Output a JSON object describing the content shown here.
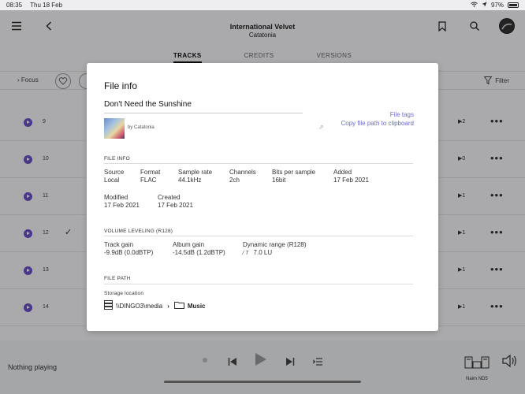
{
  "status": {
    "time": "08:35",
    "date": "Thu 18 Feb",
    "battery": "97%"
  },
  "header": {
    "album": "International Velvet",
    "artist": "Catatonia"
  },
  "tabs": [
    {
      "label": "TRACKS",
      "active": true
    },
    {
      "label": "CREDITS",
      "active": false
    },
    {
      "label": "VERSIONS",
      "active": false
    }
  ],
  "toolbar": {
    "focus_label": "Focus",
    "filter_label": "Filter"
  },
  "tracks": [
    {
      "num": "9",
      "plays": "2",
      "checked": false
    },
    {
      "num": "10",
      "plays": "0",
      "checked": false
    },
    {
      "num": "11",
      "plays": "1",
      "checked": false
    },
    {
      "num": "12",
      "plays": "1",
      "checked": true
    },
    {
      "num": "13",
      "plays": "1",
      "checked": false
    },
    {
      "num": "14",
      "plays": "1",
      "checked": false
    }
  ],
  "player": {
    "status_text": "Nothing playing",
    "device_label": "Naim ND5"
  },
  "modal": {
    "title": "File info",
    "track_title": "Don't Need the Sunshine",
    "links": {
      "file_tags": "File tags",
      "copy_path": "Copy file path to clipboard"
    },
    "by_prefix": "by",
    "by_artist": "Catatonia",
    "file_info": {
      "heading": "FILE INFO",
      "fields": [
        {
          "label": "Source",
          "value": "Local"
        },
        {
          "label": "Format",
          "value": "FLAC"
        },
        {
          "label": "Sample rate",
          "value": "44.1kHz"
        },
        {
          "label": "Channels",
          "value": "2ch"
        },
        {
          "label": "Bits per sample",
          "value": "16bit"
        },
        {
          "label": "Added",
          "value": "17 Feb 2021"
        },
        {
          "label": "Modified",
          "value": "17 Feb 2021"
        },
        {
          "label": "Created",
          "value": "17 Feb 2021"
        }
      ]
    },
    "leveling": {
      "heading": "VOLUME LEVELING (R128)",
      "track_gain_label": "Track gain",
      "track_gain_value": "-9.9dB  (0.0dBTP)",
      "album_gain_label": "Album gain",
      "album_gain_value": "-14.5dB (1.2dBTP)",
      "dr_label": "Dynamic range (R128)",
      "dr_badge": "7",
      "dr_value": "7.0 LU"
    },
    "file_path": {
      "heading": "FILE PATH",
      "storage_label": "Storage location",
      "root": "\\\\DINGO3\\media",
      "folder": "Music"
    }
  },
  "colors": {
    "accent": "#6a50c7",
    "link": "#6a6bcf"
  }
}
